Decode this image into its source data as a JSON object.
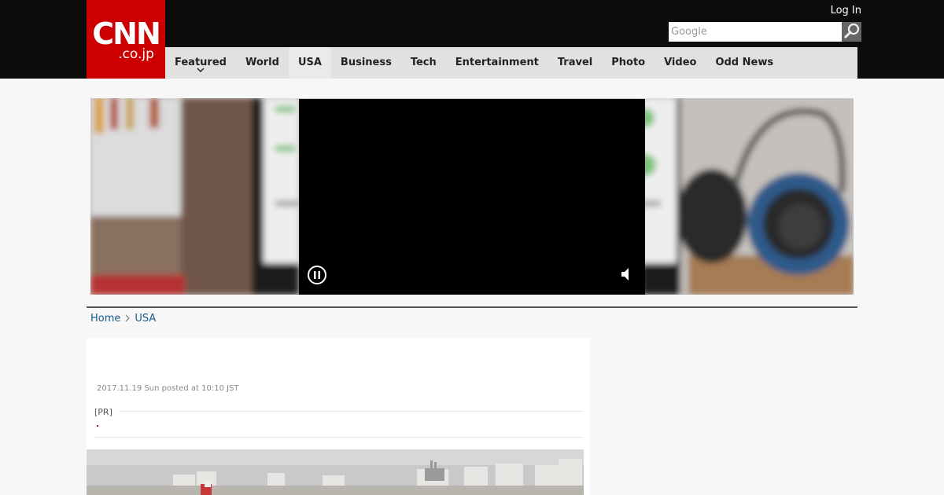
{
  "header": {
    "logo_top": "CNN",
    "logo_bottom": ".co.jp",
    "login": "Log In",
    "search_placeholder": "Google"
  },
  "nav": {
    "items": [
      {
        "label": "Featured",
        "has_dropdown": true
      },
      {
        "label": "World"
      },
      {
        "label": "USA",
        "active": true
      },
      {
        "label": "Business"
      },
      {
        "label": "Tech"
      },
      {
        "label": "Entertainment"
      },
      {
        "label": "Travel"
      },
      {
        "label": "Photo"
      },
      {
        "label": "Video"
      },
      {
        "label": "Odd News"
      }
    ]
  },
  "video": {
    "state": "playing",
    "muted": true
  },
  "breadcrumb": {
    "home": "Home",
    "current": "USA"
  },
  "article": {
    "date": "2017.11.19 Sun posted at 10:10 JST",
    "pr_label": "[PR]"
  },
  "colors": {
    "brand_red": "#cc0000",
    "topbar": "#0c0c0c",
    "nav_bg": "#e1e1e1",
    "link": "#1a5a8a"
  }
}
